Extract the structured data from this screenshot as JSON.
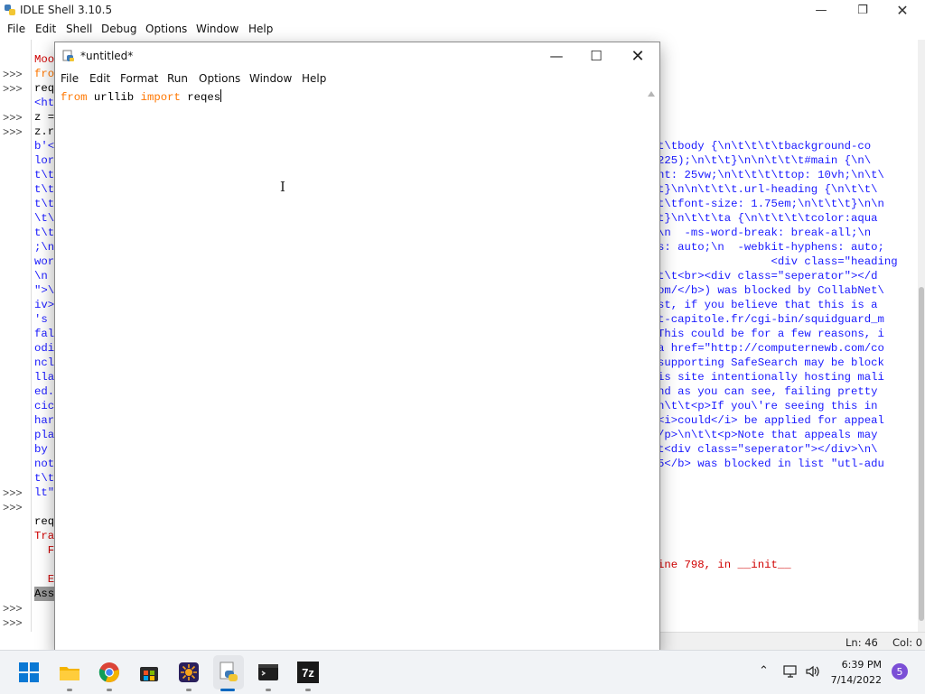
{
  "shell": {
    "title": "IDLE Shell 3.10.5",
    "menu": [
      "File",
      "Edit",
      "Shell",
      "Debug",
      "Options",
      "Window",
      "Help"
    ],
    "prompt": ">>>",
    "left_fragments": [
      "Moo",
      "fro",
      "req",
      "<ht",
      "z =",
      "z.r",
      "b'<",
      "lor",
      "t\\t",
      "t\\t",
      "t\\t",
      "\\t\\",
      "t\\t",
      ";\\n",
      "wor",
      "\\n ",
      "\">\\",
      "iv>",
      "'s ",
      "fal",
      "odi",
      "ncl",
      "lla",
      "ed.",
      "cic",
      "har",
      "pla",
      "by ",
      "not",
      "t\\t",
      "lt\"",
      "req",
      "Tra",
      "  F",
      "  E",
      "Ass"
    ],
    "right_lines": [
      "t\\tbody {\\n\\t\\t\\t\\tbackground-co",
      "225);\\n\\t\\t}\\n\\n\\t\\t\\t#main {\\n\\",
      "nt: 25vw;\\n\\t\\t\\t\\ttop: 10vh;\\n\\t\\",
      "t}\\n\\n\\t\\t\\t.url-heading {\\n\\t\\t\\",
      "t\\tfont-size: 1.75em;\\n\\t\\t\\t}\\n\\n",
      "t}\\n\\t\\t\\ta {\\n\\t\\t\\t\\tcolor:aqua",
      "\\n  -ms-word-break: break-all;\\n",
      "s: auto;\\n  -webkit-hyphens: auto;",
      "                 <div class=\"heading",
      "t\\t<br><div class=\"seperator\"></d",
      "om/</b>) was blocked by CollabNet\\",
      "st, if you believe that this is a",
      "t-capitole.fr/cgi-bin/squidguard_m",
      "This could be for a few reasons, i",
      "a href=\"http://computernewb.com/co",
      "supporting SafeSearch may be block",
      "is site intentionally hosting mali",
      "nd as you can see, failing pretty",
      "n\\t\\t<p>If you\\'re seeing this in",
      "<i>could</i> be applied for appeal",
      "/p>\\n\\t\\t<p>Note that appeals may",
      "t<div class=\"seperator\"></div>\\n\\",
      "5</b> was blocked in list \"utl-adu"
    ],
    "error_line": "ine 798, in __init__",
    "status": {
      "ln": "Ln: 46",
      "col": "Col: 0"
    }
  },
  "editor": {
    "title": "*untitled*",
    "menu": [
      "File",
      "Edit",
      "Format",
      "Run",
      "Options",
      "Window",
      "Help"
    ],
    "code": {
      "kw1": "from",
      "mod": " urllib ",
      "kw2": "import",
      "rest": " reqes"
    }
  },
  "taskbar": {
    "apps": [
      "start-icon",
      "file-explorer-icon",
      "chrome-icon",
      "store-icon",
      "sun-app-icon",
      "python-idle-icon",
      "terminal-icon",
      "7zip-icon"
    ],
    "time": "6:39 PM",
    "date": "7/14/2022",
    "notification_count": "5",
    "sevenzip_label": "7z"
  },
  "colors": {
    "keyword": "#ff7700",
    "output": "#1a1aff",
    "error": "#d00000",
    "accent": "#0067c0"
  }
}
